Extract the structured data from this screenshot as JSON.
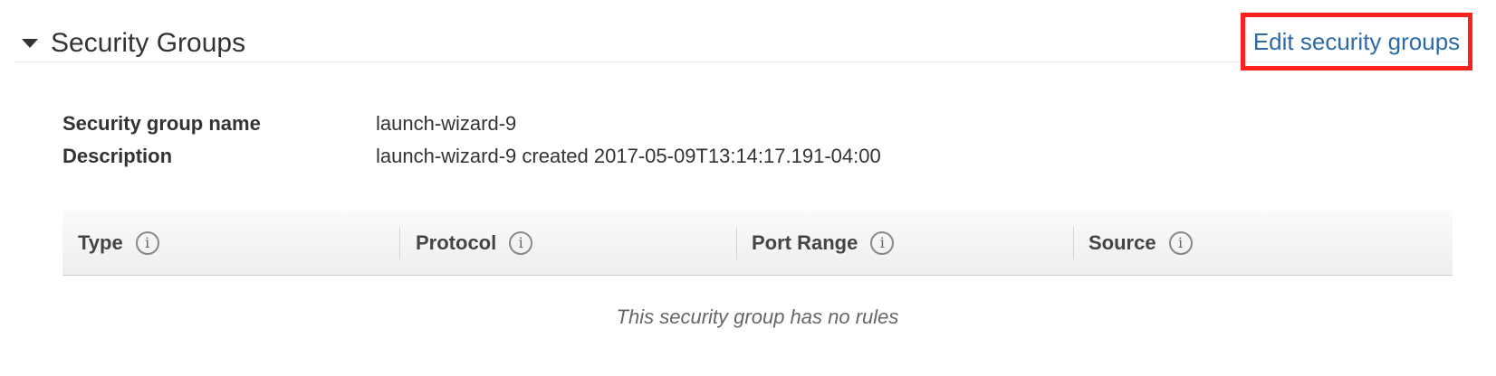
{
  "section": {
    "title": "Security Groups",
    "edit_link": "Edit security groups"
  },
  "details": [
    {
      "label": "Security group name",
      "value": "launch-wizard-9"
    },
    {
      "label": "Description",
      "value": "launch-wizard-9 created 2017-05-09T13:14:17.191-04:00"
    }
  ],
  "table": {
    "columns": [
      {
        "label": "Type",
        "info_icon": "i"
      },
      {
        "label": "Protocol",
        "info_icon": "i"
      },
      {
        "label": "Port Range",
        "info_icon": "i"
      },
      {
        "label": "Source",
        "info_icon": "i"
      }
    ],
    "empty_message": "This security group has no rules"
  },
  "colors": {
    "link": "#2d6aa8",
    "highlight_box": "#ff2020"
  }
}
